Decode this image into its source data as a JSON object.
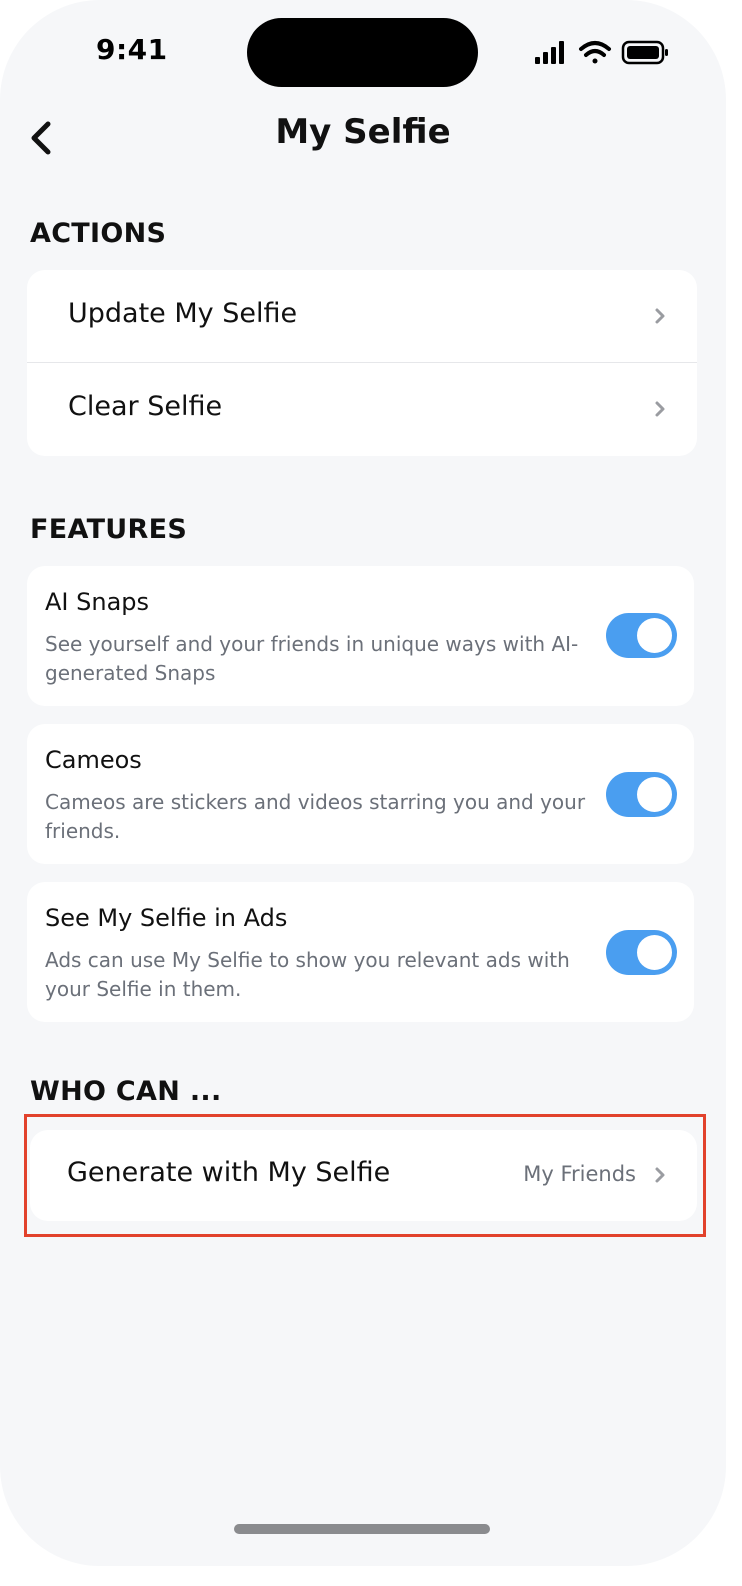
{
  "status_bar": {
    "time": "9:41",
    "icons": [
      "cellular-signal-icon",
      "wifi-icon",
      "battery-icon"
    ]
  },
  "header": {
    "title": "My Selfie",
    "back_icon": "chevron-left-icon"
  },
  "sections": {
    "actions": {
      "header": "ACTIONS",
      "items": [
        {
          "label": "Update My Selfie"
        },
        {
          "label": "Clear Selfie"
        }
      ]
    },
    "features": {
      "header": "FEATURES",
      "items": [
        {
          "title": "AI Snaps",
          "description": "See yourself and your friends in unique ways with AI-generated Snaps",
          "enabled": true
        },
        {
          "title": "Cameos",
          "description": "Cameos are stickers and videos starring you and your friends.",
          "enabled": true
        },
        {
          "title": "See My Selfie in Ads",
          "description": "Ads can use My Selfie to show you relevant ads with your Selfie in them.",
          "enabled": true
        }
      ]
    },
    "who_can": {
      "header": "WHO CAN ...",
      "items": [
        {
          "label": "Generate with My Selfie",
          "value": "My Friends"
        }
      ]
    }
  },
  "colors": {
    "background": "#f6f7f9",
    "card": "#ffffff",
    "toggle_on": "#4a9ef0",
    "highlight": "#e2422c",
    "secondary_text": "#6b7079"
  }
}
